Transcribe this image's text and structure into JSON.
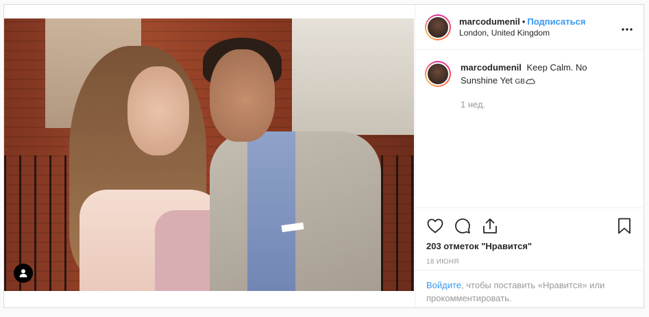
{
  "header": {
    "username": "marcodumenil",
    "separator": "•",
    "follow_label": "Подписаться",
    "location": "London, United Kingdom",
    "more_icon": "more-horizontal-icon"
  },
  "caption": {
    "username": "marcodumenil",
    "text": "Keep Calm. No Sunshine Yet",
    "flag_text": "GB",
    "weather_icon": "cloud-icon",
    "time_ago": "1 нед."
  },
  "actions": {
    "like_icon": "heart-icon",
    "comment_icon": "comment-icon",
    "share_icon": "share-icon",
    "save_icon": "bookmark-icon",
    "likes_text": "203 отметок \"Нравится\"",
    "date": "18 ИЮНЯ"
  },
  "login_prompt": {
    "link": "Войдите",
    "text": ", чтобы поставить «Нравится» или прокомментировать."
  },
  "photo": {
    "user_tags_icon": "user-icon"
  },
  "colors": {
    "accent": "#3897f0",
    "text": "#262626",
    "muted": "#999999",
    "border": "#efefef"
  }
}
